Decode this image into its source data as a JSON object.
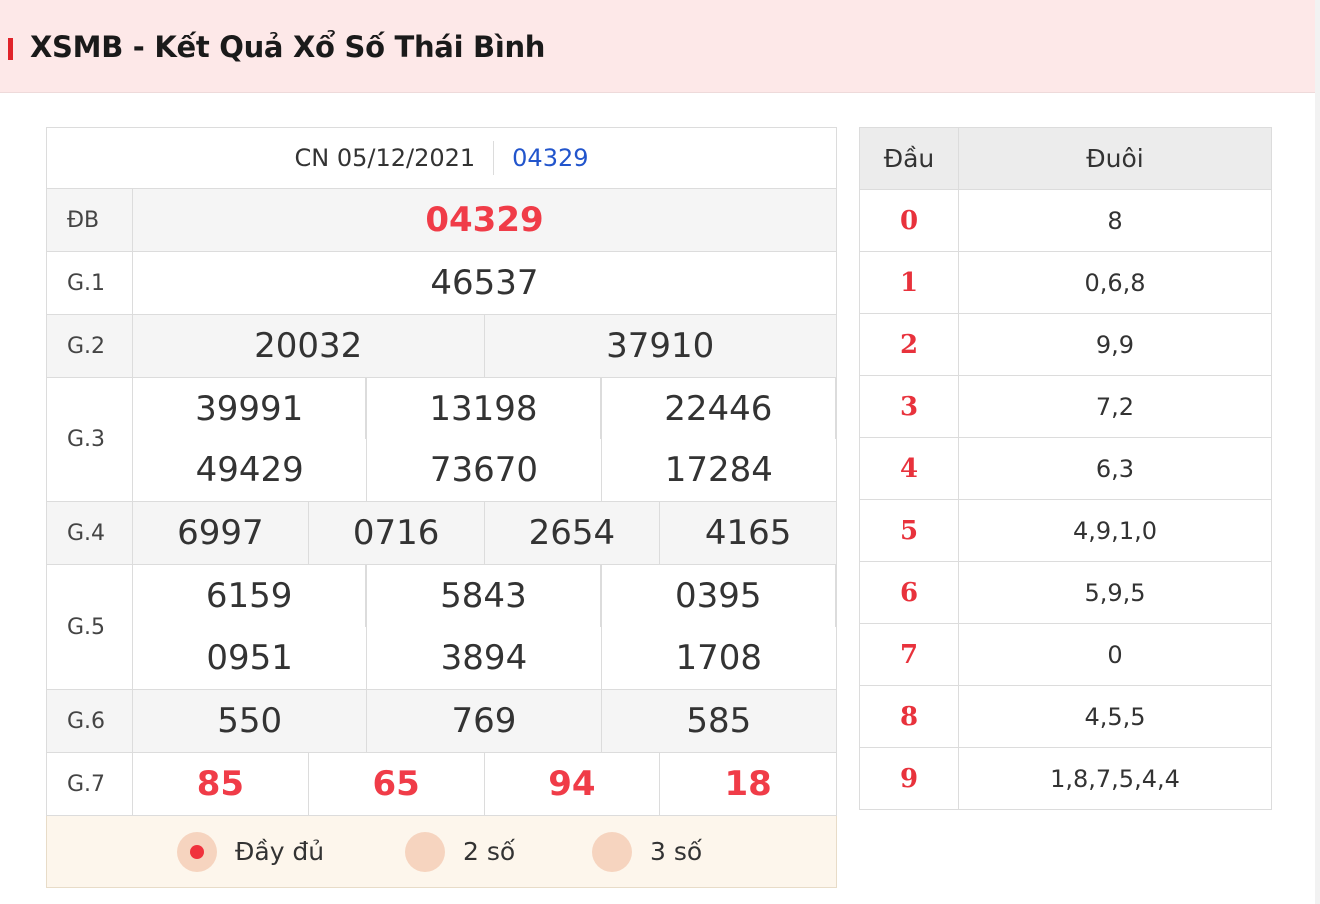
{
  "header": {
    "title": "XSMB - Kết Quả Xổ Số Thái Bình"
  },
  "draw": {
    "date": "CN 05/12/2021",
    "code": "04329"
  },
  "prizes": {
    "db": {
      "label": "ĐB",
      "values": [
        "04329"
      ]
    },
    "g1": {
      "label": "G.1",
      "values": [
        "46537"
      ]
    },
    "g2": {
      "label": "G.2",
      "values": [
        "20032",
        "37910"
      ]
    },
    "g3": {
      "label": "G.3",
      "values": [
        "39991",
        "13198",
        "22446",
        "49429",
        "73670",
        "17284"
      ]
    },
    "g4": {
      "label": "G.4",
      "values": [
        "6997",
        "0716",
        "2654",
        "4165"
      ]
    },
    "g5": {
      "label": "G.5",
      "values": [
        "6159",
        "5843",
        "0395",
        "0951",
        "3894",
        "1708"
      ]
    },
    "g6": {
      "label": "G.6",
      "values": [
        "550",
        "769",
        "585"
      ]
    },
    "g7": {
      "label": "G.7",
      "values": [
        "85",
        "65",
        "94",
        "18"
      ]
    }
  },
  "options": [
    {
      "label": "Đầy đủ",
      "selected": true
    },
    {
      "label": "2 số",
      "selected": false
    },
    {
      "label": "3 số",
      "selected": false
    }
  ],
  "dau_duoi": {
    "head_label": "Đầu",
    "tail_label": "Đuôi",
    "rows": [
      {
        "dau": "0",
        "duoi": "8"
      },
      {
        "dau": "1",
        "duoi": "0,6,8"
      },
      {
        "dau": "2",
        "duoi": "9,9"
      },
      {
        "dau": "3",
        "duoi": "7,2"
      },
      {
        "dau": "4",
        "duoi": "6,3"
      },
      {
        "dau": "5",
        "duoi": "4,9,1,0"
      },
      {
        "dau": "6",
        "duoi": "5,9,5"
      },
      {
        "dau": "7",
        "duoi": "0"
      },
      {
        "dau": "8",
        "duoi": "4,5,5"
      },
      {
        "dau": "9",
        "duoi": "1,8,7,5,4,4"
      }
    ]
  },
  "colors": {
    "accent": "#e0232a",
    "highlight_number": "#f03c48",
    "code_link": "#2255cc",
    "header_bg": "#fde8e8"
  }
}
